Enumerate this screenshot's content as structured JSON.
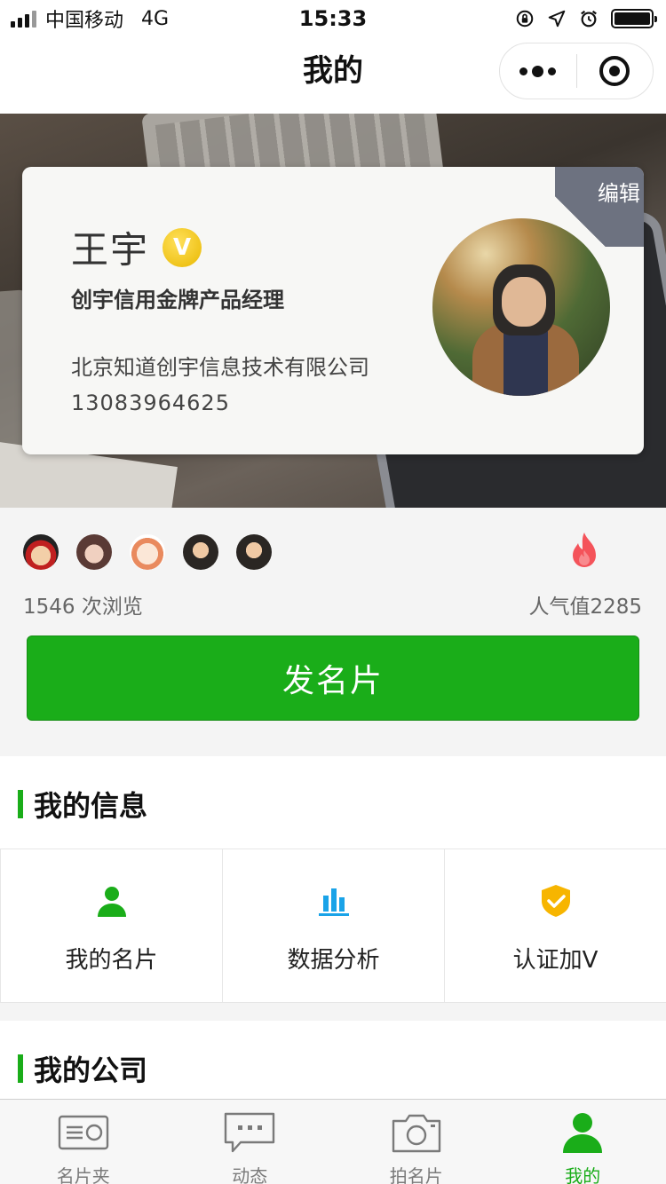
{
  "status_bar": {
    "carrier": "中国移动",
    "network": "4G",
    "time": "15:33",
    "icons": [
      "signal-icon",
      "orientation-lock-icon",
      "location-icon",
      "alarm-icon",
      "battery-icon"
    ]
  },
  "nav": {
    "title": "我的",
    "more_icon": "more-dots-icon",
    "close_icon": "miniprogram-close-icon"
  },
  "card": {
    "edit_label": "编辑",
    "name": "王宇",
    "verified_badge": "V",
    "job_title": "创宇信用金牌产品经理",
    "company": "北京知道创宇信息技术有限公司",
    "phone": "13083964625"
  },
  "stats": {
    "views": "1546 次浏览",
    "popularity": "人气值2285",
    "viewer_count_shown": 5
  },
  "actions": {
    "send_card": "发名片"
  },
  "my_info": {
    "title": "我的信息",
    "items": [
      {
        "label": "我的名片",
        "icon": "person-icon"
      },
      {
        "label": "数据分析",
        "icon": "bar-chart-icon"
      },
      {
        "label": "认证加V",
        "icon": "shield-check-icon"
      }
    ]
  },
  "my_company": {
    "title": "我的公司"
  },
  "tabbar": {
    "items": [
      {
        "label": "名片夹",
        "icon": "card-holder-icon",
        "active": false
      },
      {
        "label": "动态",
        "icon": "chat-bubble-icon",
        "active": false
      },
      {
        "label": "拍名片",
        "icon": "camera-icon",
        "active": false
      },
      {
        "label": "我的",
        "icon": "person-icon",
        "active": true
      }
    ]
  },
  "colors": {
    "accent_green": "#1aad19",
    "badge_gold": "#f2c400",
    "flame_red": "#f4535a",
    "shield_yellow": "#f7b500",
    "chart_blue": "#1aa3e8"
  }
}
